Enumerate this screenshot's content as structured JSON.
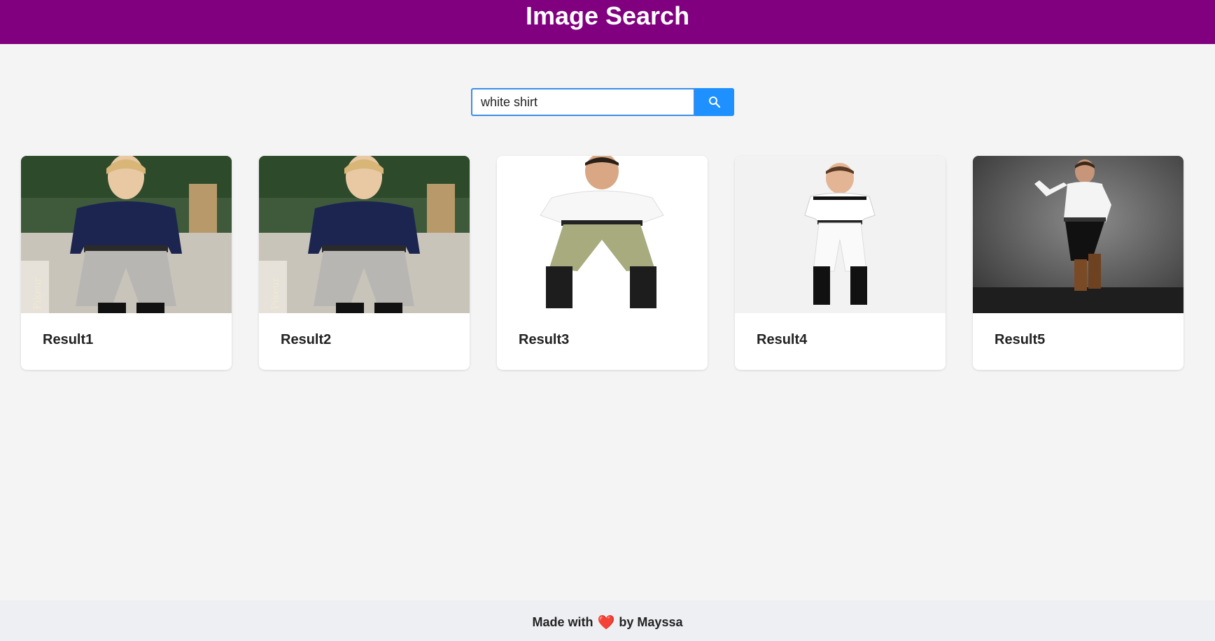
{
  "header": {
    "title": "Image Search"
  },
  "search": {
    "value": "white shirt",
    "button_icon": "search-icon",
    "accent": "#1e90ff"
  },
  "results": [
    {
      "label": "Result1",
      "image": "man in navy polo shirt and grey riding breeches"
    },
    {
      "label": "Result2",
      "image": "man in navy polo shirt and grey riding breeches"
    },
    {
      "label": "Result3",
      "image": "man in white polo shirt and olive riding breeches"
    },
    {
      "label": "Result4",
      "image": "boy in white show shirt and white breeches"
    },
    {
      "label": "Result5",
      "image": "man in white shirt and black trousers with brown boots"
    }
  ],
  "footer": {
    "prefix": "Made with",
    "icon": "heart-icon",
    "suffix": "by Mayssa"
  },
  "colors": {
    "header_bg": "#800080",
    "page_bg": "#f4f4f4",
    "footer_bg": "#eeeff3"
  }
}
